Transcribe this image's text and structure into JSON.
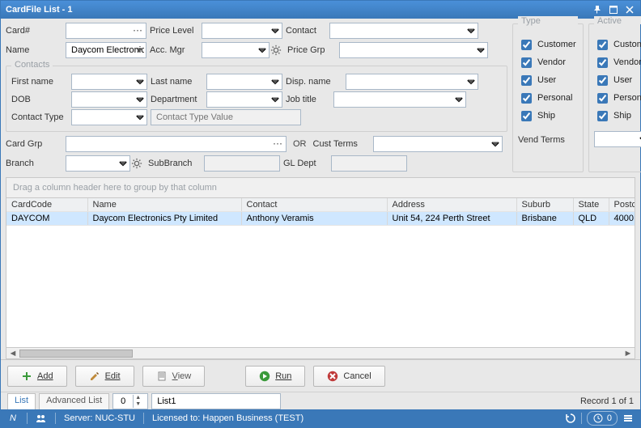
{
  "title": "CardFile List - 1",
  "labels": {
    "cardno": "Card#",
    "name": "Name",
    "pricelevel": "Price Level",
    "accmgr": "Acc. Mgr",
    "contact": "Contact",
    "pricegrp": "Price Grp",
    "firstname": "First name",
    "lastname": "Last name",
    "dispname": "Disp. name",
    "dob": "DOB",
    "department": "Department",
    "jobtitle": "Job title",
    "contacttype": "Contact Type",
    "contacttype_value_placeholder": "Contact Type Value",
    "cardgrp": "Card Grp",
    "or": "OR",
    "branch": "Branch",
    "subbranch": "SubBranch",
    "custterms": "Cust Terms",
    "vendterms": "Vend Terms",
    "gldept": "GL Dept"
  },
  "name_value": "Daycom Electronics",
  "contacts_legend": "Contacts",
  "type_legend": "Type",
  "active_legend": "Active",
  "type": {
    "customer": "Customer",
    "vendor": "Vendor",
    "user": "User",
    "personal": "Personal",
    "ship": "Ship"
  },
  "group_hint": "Drag a column header here to group by that column",
  "grid": {
    "cols": [
      "CardCode",
      "Name",
      "Contact",
      "Address",
      "Suburb",
      "State",
      "Postcode"
    ],
    "rows": [
      {
        "CardCode": "DAYCOM",
        "Name": "Daycom Electronics Pty Limited",
        "Contact": "Anthony Veramis",
        "Address": "Unit 54, 224 Perth Street",
        "Suburb": "Brisbane",
        "State": "QLD",
        "Postcode": "4000"
      }
    ]
  },
  "buttons": {
    "add": "Add",
    "edit": "Edit",
    "view": "View",
    "run": "Run",
    "cancel": "Cancel"
  },
  "listbar": {
    "tab_list": "List",
    "tab_adv": "Advanced List",
    "count": "0",
    "name": "List1",
    "record": "Record 1 of 1"
  },
  "status": {
    "server": "Server: NUC-STU",
    "licensed": "Licensed to: Happen Business (TEST)",
    "clock": "0"
  }
}
